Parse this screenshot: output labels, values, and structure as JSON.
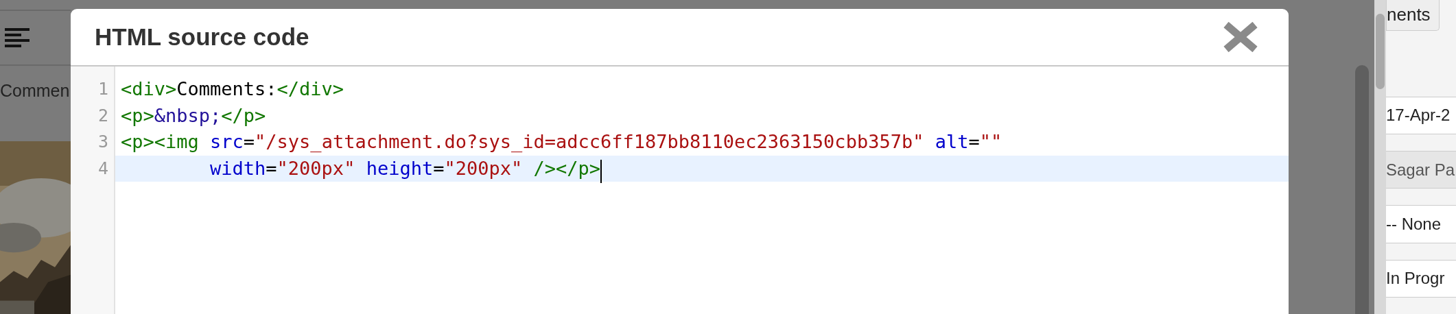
{
  "background": {
    "toolbar_label": "Commen"
  },
  "dialog": {
    "title": "HTML source code",
    "code_lines": [
      {
        "number": "1",
        "selected": false,
        "tokens": [
          {
            "kind": "tag",
            "text": "<div>"
          },
          {
            "kind": "text",
            "text": "Comments:"
          },
          {
            "kind": "tag",
            "text": "</div>"
          }
        ]
      },
      {
        "number": "2",
        "selected": false,
        "tokens": [
          {
            "kind": "tag",
            "text": "<p>"
          },
          {
            "kind": "entity",
            "text": "&nbsp;"
          },
          {
            "kind": "tag",
            "text": "</p>"
          }
        ]
      },
      {
        "number": "3",
        "selected": false,
        "tokens": [
          {
            "kind": "tag",
            "text": "<p><img"
          },
          {
            "kind": "attribute",
            "text": " src"
          },
          {
            "kind": "text",
            "text": "="
          },
          {
            "kind": "string",
            "text": "\"/sys_attachment.do?sys_id=adcc6ff187bb8110ec2363150cbb357b\""
          },
          {
            "kind": "attribute",
            "text": " alt"
          },
          {
            "kind": "text",
            "text": "="
          },
          {
            "kind": "string",
            "text": "\"\""
          }
        ]
      },
      {
        "number": "4",
        "selected": true,
        "tokens": [
          {
            "kind": "attribute",
            "text": "        width"
          },
          {
            "kind": "text",
            "text": "="
          },
          {
            "kind": "string",
            "text": "\"200px\""
          },
          {
            "kind": "attribute",
            "text": " height"
          },
          {
            "kind": "text",
            "text": "="
          },
          {
            "kind": "string",
            "text": "\"200px\""
          },
          {
            "kind": "tag",
            "text": " /></p>"
          }
        ]
      }
    ]
  },
  "side_panel": [
    {
      "kind": "button",
      "text": "nents"
    },
    {
      "kind": "field",
      "text": "17-Apr-2",
      "disabled": false
    },
    {
      "kind": "field",
      "text": "Sagar Pa",
      "disabled": true
    },
    {
      "kind": "field",
      "text": "-- None",
      "disabled": false
    },
    {
      "kind": "field",
      "text": "In Progr",
      "disabled": false
    }
  ]
}
